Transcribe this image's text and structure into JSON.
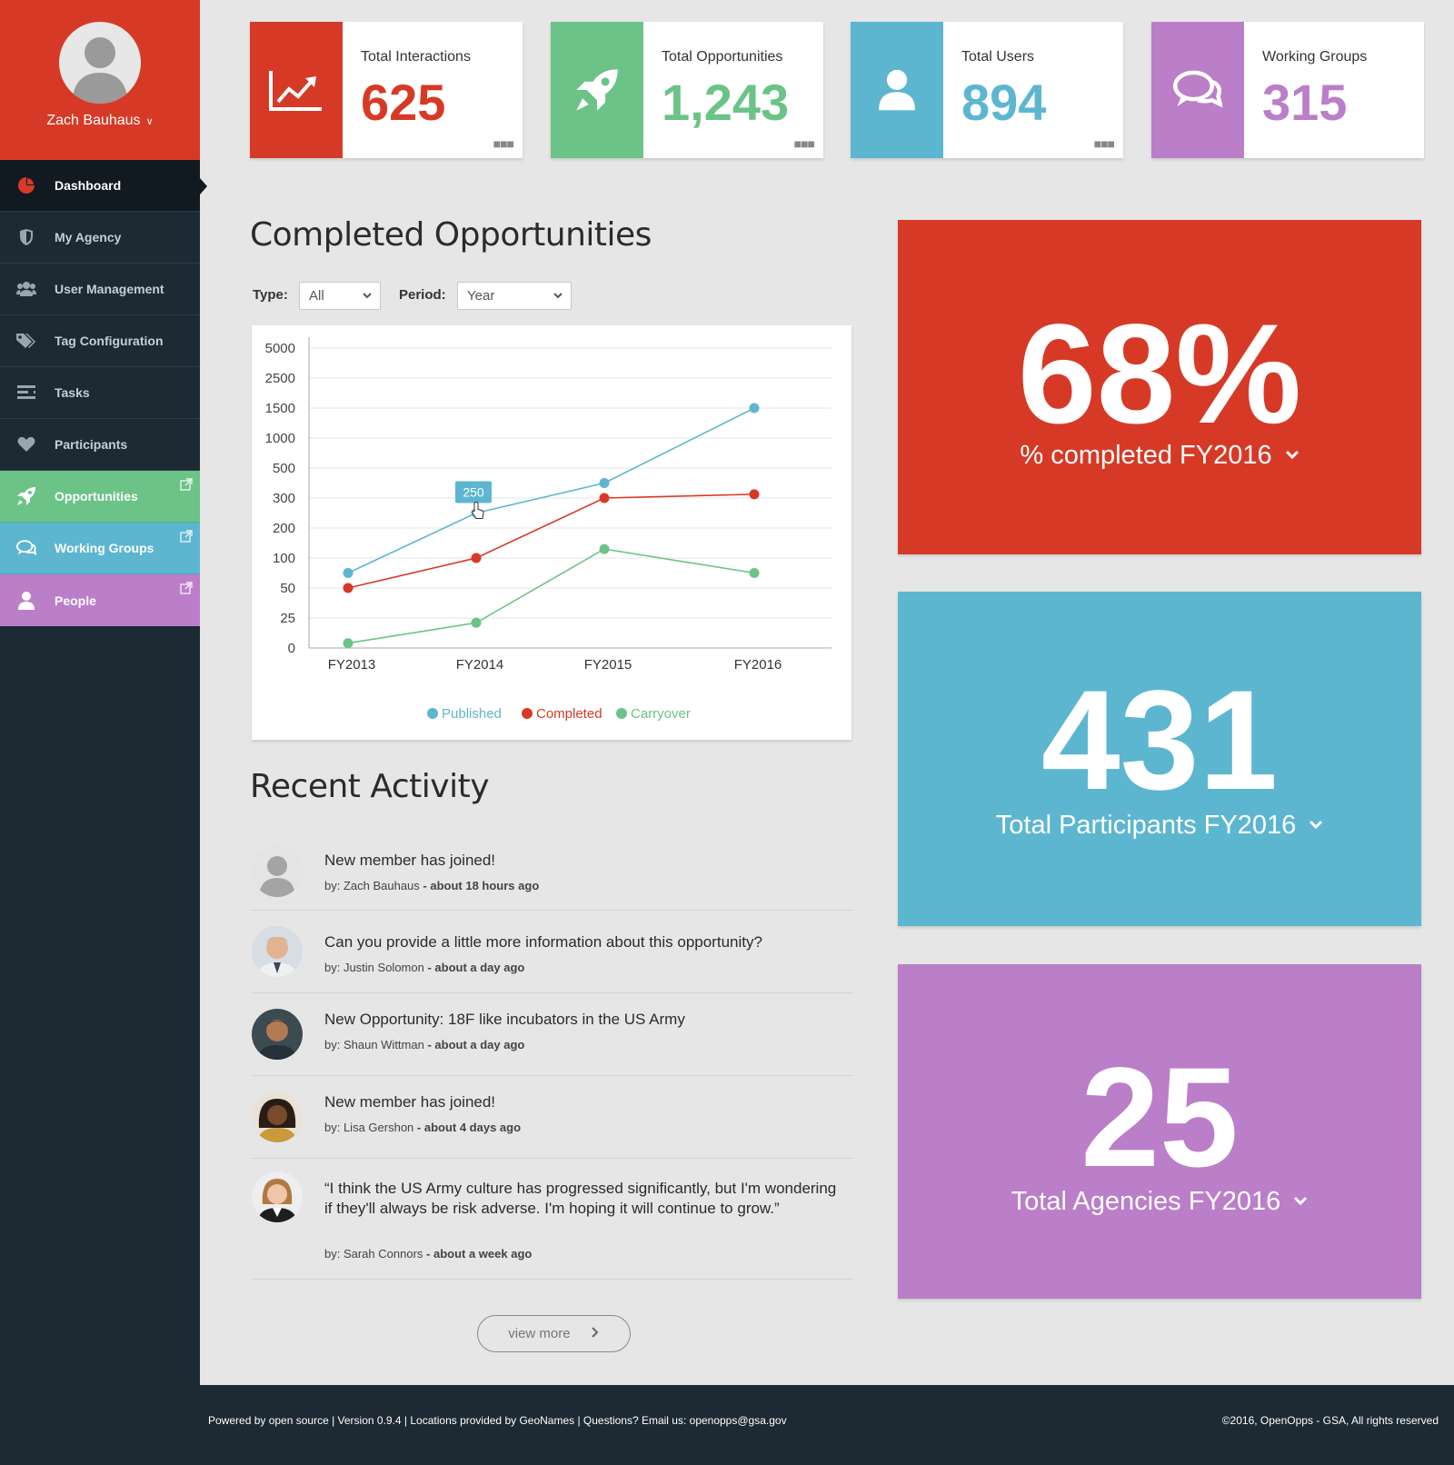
{
  "profile": {
    "name": "Zach Bauhaus"
  },
  "nav": [
    {
      "label": "Dashboard",
      "icon": "pie-chart-icon"
    },
    {
      "label": "My Agency",
      "icon": "shield-icon"
    },
    {
      "label": "User Management",
      "icon": "users-icon"
    },
    {
      "label": "Tag Configuration",
      "icon": "tags-icon"
    },
    {
      "label": "Tasks",
      "icon": "tasks-icon"
    },
    {
      "label": "Participants",
      "icon": "heart-icon"
    },
    {
      "label": "Opportunities",
      "icon": "rocket-icon"
    },
    {
      "label": "Working Groups",
      "icon": "chat-icon"
    },
    {
      "label": "People",
      "icon": "person-icon"
    }
  ],
  "stats": [
    {
      "label": "Total Interactions",
      "value": "625",
      "color": "#d63a26",
      "icon": "trend-chart-icon"
    },
    {
      "label": "Total Opportunities",
      "value": "1,243",
      "color": "#6bc387",
      "icon": "rocket-icon"
    },
    {
      "label": "Total Users",
      "value": "894",
      "color": "#5db6d0",
      "icon": "user-icon"
    },
    {
      "label": "Working Groups",
      "value": "315",
      "color": "#bb7ec8",
      "icon": "chat-icon"
    }
  ],
  "chart_section": {
    "title": "Completed Opportunities",
    "type_label": "Type:",
    "type_value": "All",
    "period_label": "Period:",
    "period_value": "Year",
    "tooltip": "250"
  },
  "chart_data": {
    "type": "line",
    "categories": [
      "FY2013",
      "FY2014",
      "FY2015",
      "FY2016"
    ],
    "y_ticks": [
      "0",
      "25",
      "50",
      "100",
      "200",
      "300",
      "500",
      "1000",
      "1500",
      "2500",
      "5000"
    ],
    "series": [
      {
        "name": "Published",
        "color": "#5db6d0",
        "values": [
          75,
          250,
          400,
          1500
        ]
      },
      {
        "name": "Completed",
        "color": "#d63a26",
        "values": [
          50,
          100,
          300,
          325
        ]
      },
      {
        "name": "Carryover",
        "color": "#6bc387",
        "values": [
          4,
          21,
          130,
          75
        ]
      }
    ],
    "legend_position": "bottom-center",
    "grid": true
  },
  "activity": {
    "title": "Recent Activity",
    "items": [
      {
        "text": "New member has joined!",
        "author": "by: Zach Bauhaus",
        "time": "- about 18 hours ago"
      },
      {
        "text": "Can you provide a little more information about this opportunity?",
        "author": "by: Justin Solomon",
        "time": "- about a day ago"
      },
      {
        "text": "New Opportunity: 18F like incubators in the US Army",
        "author": "by: Shaun Wittman",
        "time": "- about a day ago"
      },
      {
        "text": "New member has joined!",
        "author": "by: Lisa Gershon",
        "time": "- about 4 days ago"
      },
      {
        "text": "“I think the US Army culture has progressed significantly, but I'm wondering if they'll always be risk adverse. I'm hoping it will continue to grow.”",
        "author": "by: Sarah Connors",
        "time": "- about a week ago"
      }
    ],
    "view_more": "view more"
  },
  "panels": [
    {
      "value": "68%",
      "label": "% completed  FY2016",
      "color": "#d63a26"
    },
    {
      "value": "431",
      "label": "Total Participants  FY2016",
      "color": "#5db6d0"
    },
    {
      "value": "25",
      "label": "Total Agencies  FY2016",
      "color": "#bb7ec8"
    }
  ],
  "footer": {
    "left": "Powered by open source | Version 0.9.4 | Locations provided by GeoNames | Questions? Email us: openopps@gsa.gov",
    "right": "©2016, OpenOpps - GSA, All rights reserved"
  }
}
